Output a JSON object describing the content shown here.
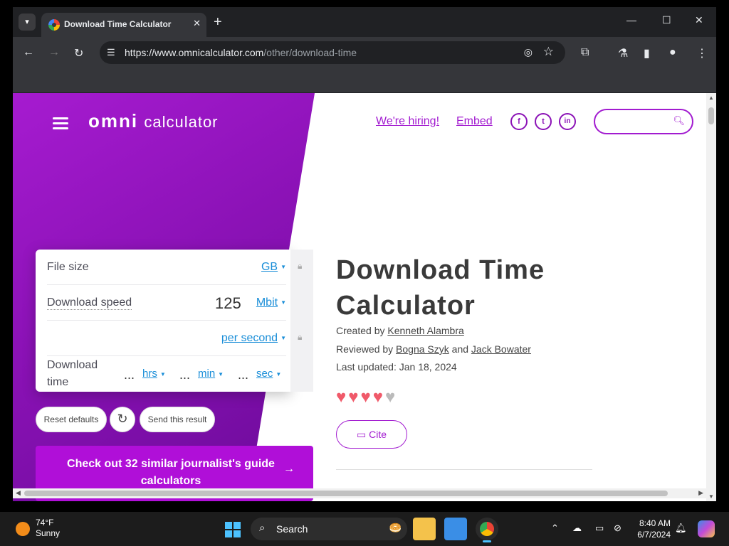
{
  "browser": {
    "tab_title": "Download Time Calculator",
    "new_tab": "+",
    "close_tab": "✕",
    "url_host": "https://www.omnicalculator.com",
    "url_path": "/other/download-time",
    "minimize": "—",
    "maximize": "☐",
    "close": "✕"
  },
  "site": {
    "logo_omni": "omni",
    "logo_calc": "calculator",
    "nav": {
      "hiring": "We're hiring!",
      "embed": "Embed"
    },
    "social": [
      "f",
      "t",
      "in"
    ]
  },
  "calculator": {
    "file_size_label": "File size",
    "file_size_unit": "GB",
    "download_speed_label": "Download speed",
    "download_speed_value": "125",
    "download_speed_unit": "Mbit",
    "per_unit": "per second",
    "download_time_label_1": "Download",
    "download_time_label_2": "time",
    "ellipsis": "...",
    "hrs": "hrs",
    "min": "min",
    "sec": "sec",
    "reset": "Reset defaults",
    "send": "Send this result",
    "cta": "Check out 32 similar journalist's guide calculators"
  },
  "article": {
    "title": "Download Time Calculator",
    "created_by_label": "Created by",
    "created_by": "Kenneth Alambra",
    "reviewed_by_label": "Reviewed by",
    "reviewer_1": "Bogna Szyk",
    "and": "and",
    "reviewer_2": "Jack Bowater",
    "last_updated": "Last updated: Jan 18, 2024",
    "rating": 4.5,
    "cite": "Cite"
  },
  "taskbar": {
    "temperature": "74°F",
    "condition": "Sunny",
    "search": "Search",
    "time": "8:40 AM",
    "date": "6/7/2024"
  },
  "colors": {
    "brand": "#a21bd0",
    "link": "#1a8ed8",
    "heart": "#f05a6a"
  }
}
